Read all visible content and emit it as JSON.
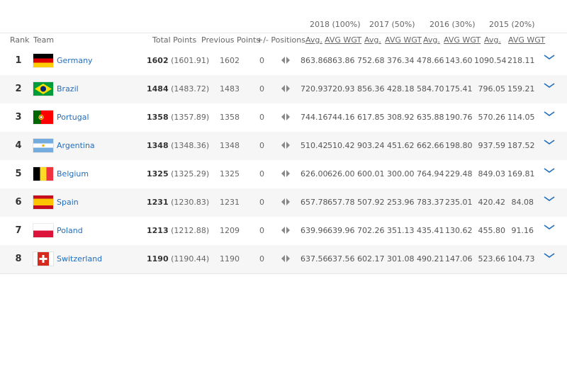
{
  "columns": {
    "rank": "Rank",
    "team": "Team",
    "total": "Total Points",
    "previous": "Previous Points",
    "positions": "+/- Positions",
    "avg1": "Avg.",
    "wgt1": "AVG WGT",
    "avg2": "Avg.",
    "wgt2": "AVG WGT",
    "avg3": "Avg.",
    "wgt3": "AVG WGT",
    "avg4": "Avg.",
    "wgt4": "AVG WGT"
  },
  "years": {
    "y1": "2018 (100%)",
    "y2": "2017 (50%)",
    "y3": "2016 (30%)",
    "y4": "2015 (20%)"
  },
  "rows": [
    {
      "rank": "1",
      "team": "Germany",
      "total": "1602",
      "total_exact": "(1601.91)",
      "prev": "1602",
      "move": "0",
      "a1": "863.86",
      "w1": "863.86",
      "a2": "752.68",
      "w2": "376.34",
      "a3": "478.66",
      "w3": "143.60",
      "a4": "1090.54",
      "w4": "218.11",
      "flag": "germany-flag-icon"
    },
    {
      "rank": "2",
      "team": "Brazil",
      "total": "1484",
      "total_exact": "(1483.72)",
      "prev": "1483",
      "move": "0",
      "a1": "720.93",
      "w1": "720.93",
      "a2": "856.36",
      "w2": "428.18",
      "a3": "584.70",
      "w3": "175.41",
      "a4": "796.05",
      "w4": "159.21",
      "flag": "brazil-flag-icon"
    },
    {
      "rank": "3",
      "team": "Portugal",
      "total": "1358",
      "total_exact": "(1357.89)",
      "prev": "1358",
      "move": "0",
      "a1": "744.16",
      "w1": "744.16",
      "a2": "617.85",
      "w2": "308.92",
      "a3": "635.88",
      "w3": "190.76",
      "a4": "570.26",
      "w4": "114.05",
      "flag": "portugal-flag-icon"
    },
    {
      "rank": "4",
      "team": "Argentina",
      "total": "1348",
      "total_exact": "(1348.36)",
      "prev": "1348",
      "move": "0",
      "a1": "510.42",
      "w1": "510.42",
      "a2": "903.24",
      "w2": "451.62",
      "a3": "662.66",
      "w3": "198.80",
      "a4": "937.59",
      "w4": "187.52",
      "flag": "argentina-flag-icon"
    },
    {
      "rank": "5",
      "team": "Belgium",
      "total": "1325",
      "total_exact": "(1325.29)",
      "prev": "1325",
      "move": "0",
      "a1": "626.00",
      "w1": "626.00",
      "a2": "600.01",
      "w2": "300.00",
      "a3": "764.94",
      "w3": "229.48",
      "a4": "849.03",
      "w4": "169.81",
      "flag": "belgium-flag-icon"
    },
    {
      "rank": "6",
      "team": "Spain",
      "total": "1231",
      "total_exact": "(1230.83)",
      "prev": "1231",
      "move": "0",
      "a1": "657.78",
      "w1": "657.78",
      "a2": "507.92",
      "w2": "253.96",
      "a3": "783.37",
      "w3": "235.01",
      "a4": "420.42",
      "w4": "84.08",
      "flag": "spain-flag-icon"
    },
    {
      "rank": "7",
      "team": "Poland",
      "total": "1213",
      "total_exact": "(1212.88)",
      "prev": "1209",
      "move": "0",
      "a1": "639.96",
      "w1": "639.96",
      "a2": "702.26",
      "w2": "351.13",
      "a3": "435.41",
      "w3": "130.62",
      "a4": "455.80",
      "w4": "91.16",
      "flag": "poland-flag-icon"
    },
    {
      "rank": "8",
      "team": "Switzerland",
      "total": "1190",
      "total_exact": "(1190.44)",
      "prev": "1190",
      "move": "0",
      "a1": "637.56",
      "w1": "637.56",
      "a2": "602.17",
      "w2": "301.08",
      "a3": "490.21",
      "w3": "147.06",
      "a4": "523.66",
      "w4": "104.73",
      "flag": "switzerland-flag-icon"
    }
  ],
  "colors": {
    "link": "#1f6dbf",
    "chevron": "#1f6dbf",
    "arrow": "#888888",
    "row_shade": "#f6f6f6"
  }
}
